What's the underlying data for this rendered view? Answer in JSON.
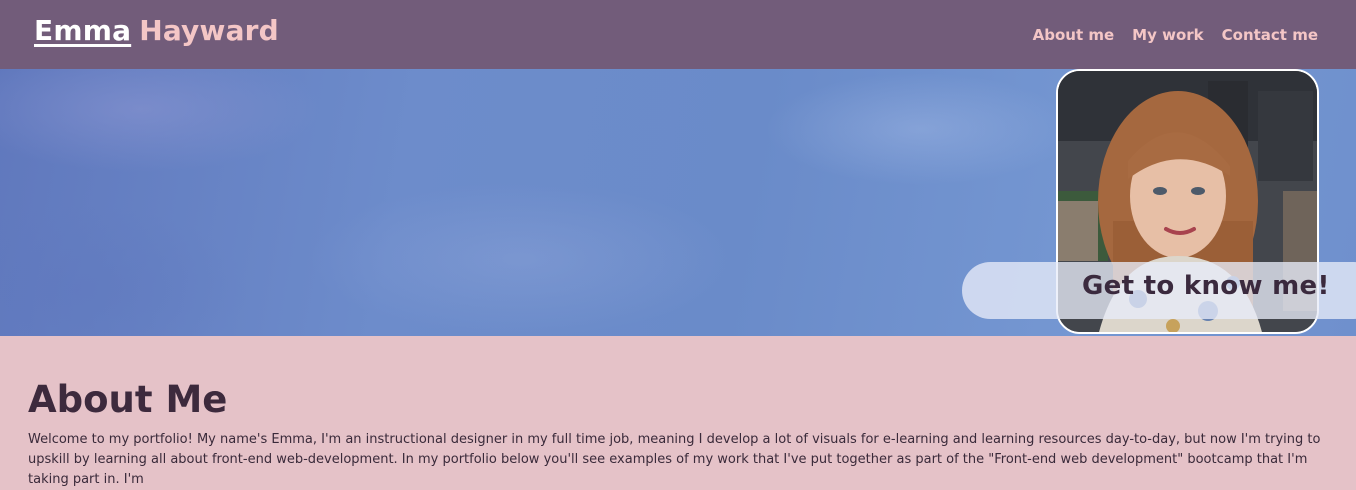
{
  "header": {
    "first_name": "Emma",
    "last_name": "Hayward",
    "nav": [
      "About me",
      "My work",
      "Contact me"
    ]
  },
  "hero": {
    "cta": "Get to know me!",
    "portrait_icon": "profile-photo"
  },
  "about": {
    "title": "About Me",
    "body": "Welcome to my portfolio! My name's Emma, I'm an instructional designer in my full time job, meaning I develop a lot of visuals for e-learning and learning resources day-to-day, but now I'm trying to upskill by learning all about front-end web-development. In my portfolio below you'll see examples of my work that I've put together as part of the \"Front-end web development\" bootcamp that I'm taking part in. I'm"
  },
  "colors": {
    "header_bg": "#725c7a",
    "accent_pink": "#f4c6c6",
    "page_bg": "#e5c2c8",
    "heading": "#3d2a3d"
  }
}
